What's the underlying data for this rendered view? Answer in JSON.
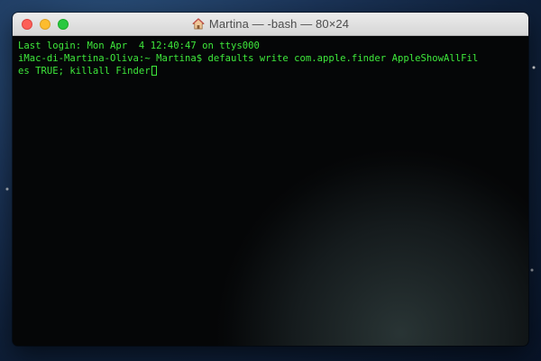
{
  "window": {
    "title": "Martina — -bash — 80×24",
    "title_icon": "home-icon",
    "buttons": [
      "close",
      "minimize",
      "zoom"
    ]
  },
  "terminal": {
    "lines": [
      "Last login: Mon Apr  4 12:40:47 on ttys000",
      "iMac-di-Martina-Oliva:~ Martina$ defaults write com.apple.finder AppleShowAllFil",
      "es TRUE; killall Finder"
    ],
    "text_color": "#3ee83b",
    "background_color": "#050607"
  }
}
